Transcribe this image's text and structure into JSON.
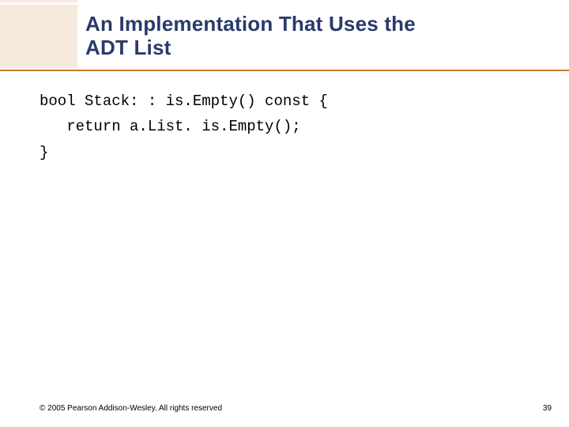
{
  "title": {
    "line1": "An Implementation That Uses the",
    "line2": "ADT List"
  },
  "code": {
    "line1": "bool Stack: : is.Empty() const {",
    "line2": "   return a.List. is.Empty();",
    "line3": "}"
  },
  "footer": {
    "copyright": "© 2005 Pearson Addison-Wesley. All rights reserved",
    "page_number": "39"
  }
}
